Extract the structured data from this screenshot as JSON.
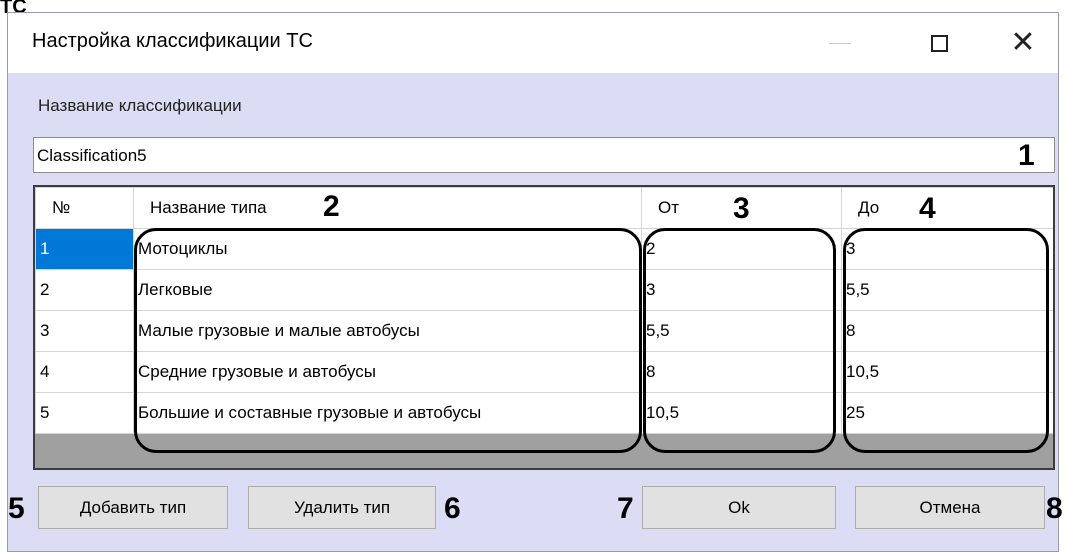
{
  "fragment": "ТС",
  "window": {
    "title": "Настройка классификации ТС"
  },
  "name_label": "Название классификации",
  "name_value": "Classification5",
  "grid": {
    "headers": [
      "№",
      "Название типа",
      "От",
      "До"
    ],
    "rows": [
      {
        "n": "1",
        "name": "Мотоциклы",
        "from": "2",
        "to": "3"
      },
      {
        "n": "2",
        "name": "Легковые",
        "from": "3",
        "to": "5,5"
      },
      {
        "n": "3",
        "name": "Малые грузовые и малые автобусы",
        "from": "5,5",
        "to": "8"
      },
      {
        "n": "4",
        "name": "Средние грузовые и автобусы",
        "from": "8",
        "to": "10,5"
      },
      {
        "n": "5",
        "name": "Большие и составные грузовые и автобусы",
        "from": "10,5",
        "to": "25"
      }
    ]
  },
  "buttons": {
    "add": "Добавить тип",
    "delete": "Удалить тип",
    "ok": "Ok",
    "cancel": "Отмена"
  },
  "callouts": [
    "1",
    "2",
    "3",
    "4",
    "5",
    "6",
    "7",
    "8"
  ],
  "colors": {
    "selected": "#0078d7",
    "window_bg": "#dcdcf4",
    "button": "#e1e1e1"
  }
}
